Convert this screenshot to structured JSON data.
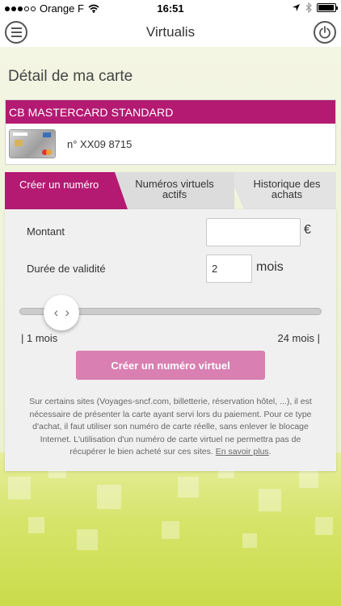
{
  "status_bar": {
    "carrier": "Orange F",
    "time": "16:51",
    "battery_level": 0.95
  },
  "nav": {
    "title": "Virtualis",
    "menu_icon": "hamburger-menu-icon",
    "power_icon": "power-icon"
  },
  "page_title": "Détail de ma carte",
  "card": {
    "name": "CB MASTERCARD STANDARD",
    "number": "n° XX09 8715"
  },
  "tabs": [
    {
      "label": "Créer un numéro",
      "active": true
    },
    {
      "label_line1": "Numéros virtuels",
      "label_line2": "actifs",
      "active": false
    },
    {
      "label_line1": "Historique des",
      "label_line2": "achats",
      "active": false
    }
  ],
  "form": {
    "amount_label": "Montant",
    "amount_value": "",
    "currency": "€",
    "validity_label": "Durée de validité",
    "validity_value": "2",
    "validity_unit": "mois",
    "slider": {
      "min_label": "| 1 mois",
      "max_label": "24 mois |",
      "min": 1,
      "max": 24,
      "value": 2
    },
    "create_button": "Créer un numéro virtuel"
  },
  "info": {
    "text": "Sur certains sites (Voyages-sncf.com, billetterie, réservation hôtel, ...), il est nécessaire de présenter la carte ayant servi lors du paiement. Pour ce type d'achat, il faut utiliser son numéro de carte réelle, sans enlever le blocage Internet. L'utilisation d'un numéro de carte virtuel ne permettra pas de récupérer le bien acheté sur ces sites.",
    "link": "En savoir plus"
  },
  "colors": {
    "brand": "#b41a72",
    "button": "#d97fb1",
    "bottom_green": "#c9dc4a"
  }
}
